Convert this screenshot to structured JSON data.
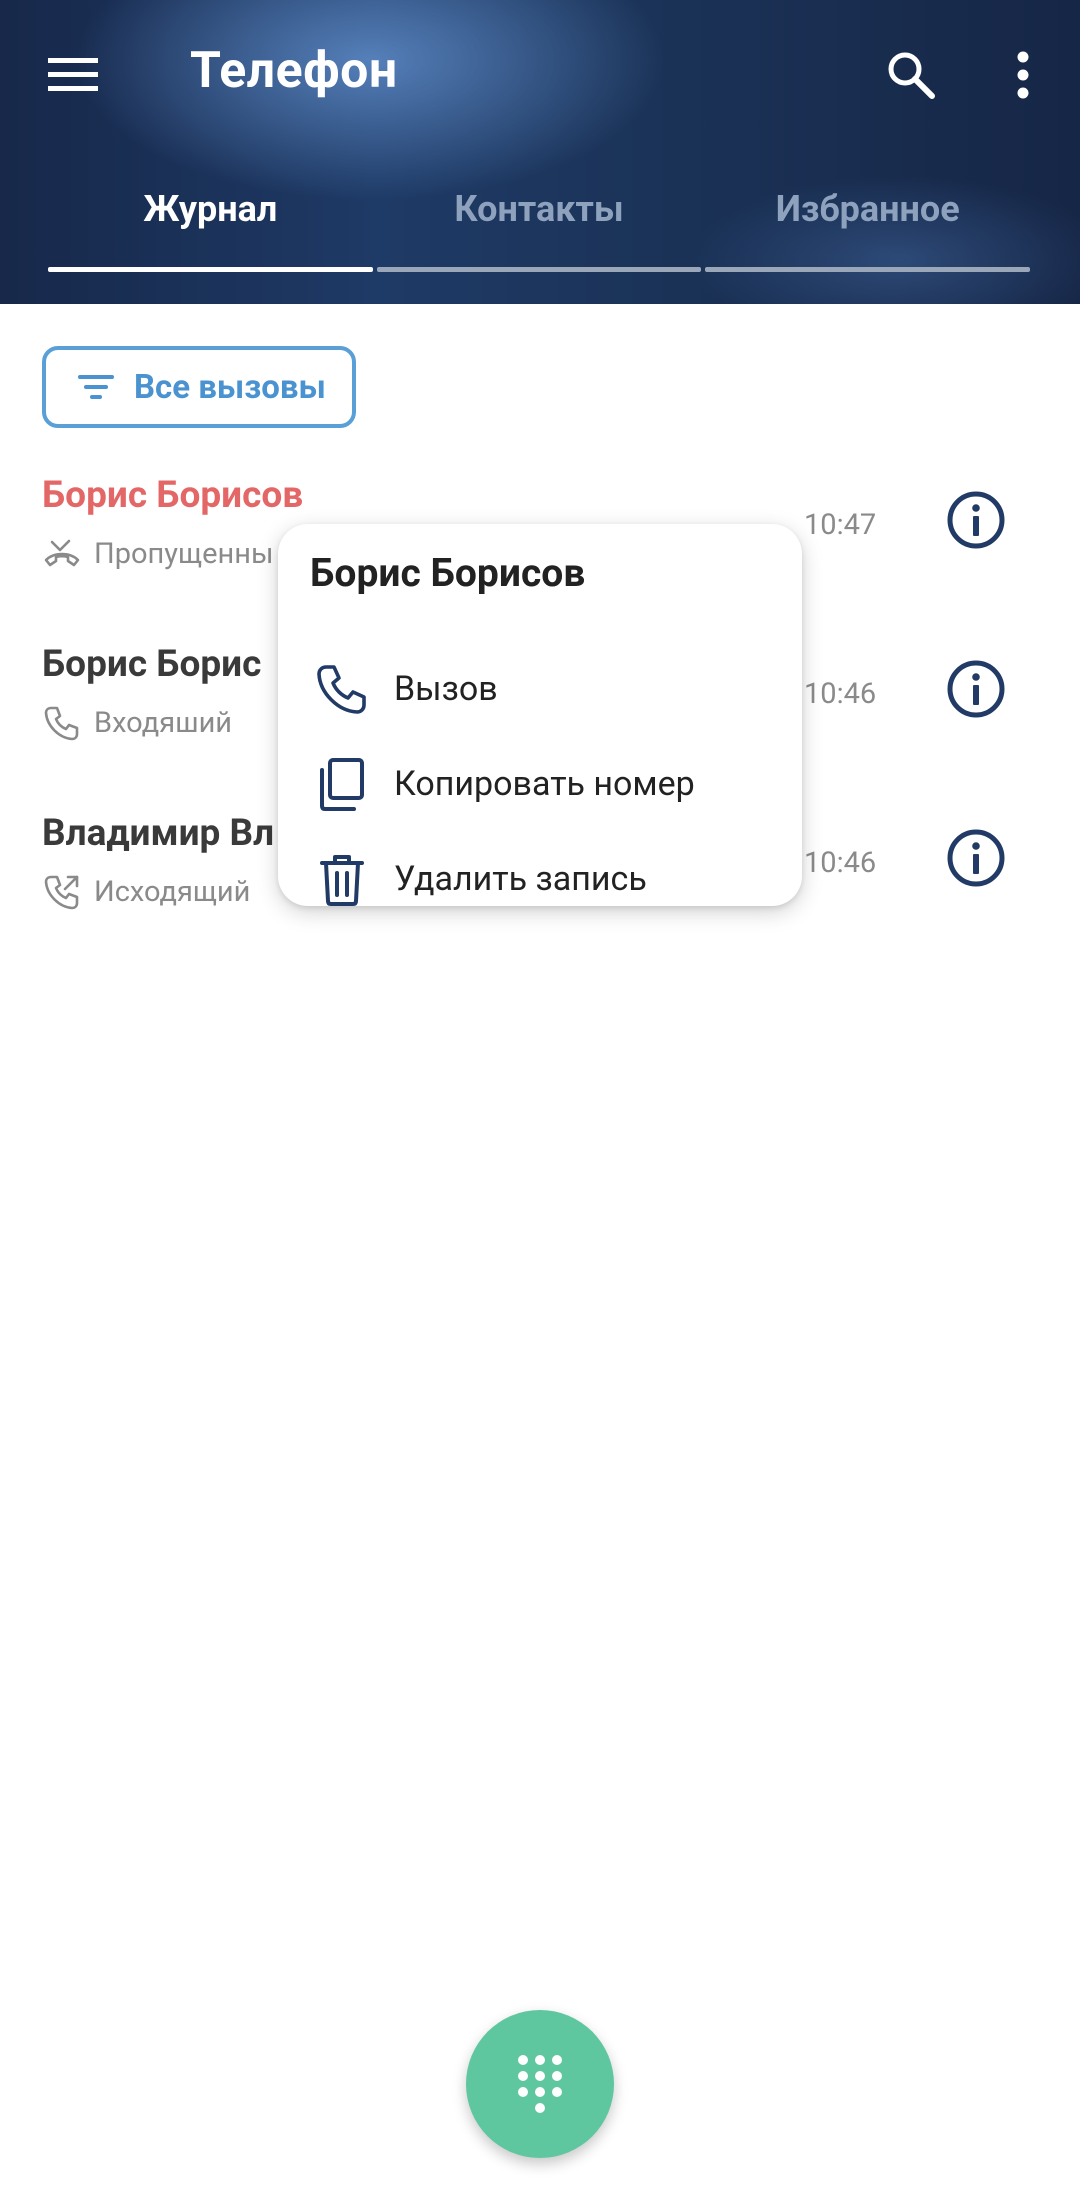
{
  "app": {
    "title": "Телефон"
  },
  "tabs": [
    {
      "label": "Журнал",
      "active": true
    },
    {
      "label": "Контакты",
      "active": false
    },
    {
      "label": "Избранное",
      "active": false
    }
  ],
  "filter": {
    "label": "Все вызовы",
    "icon": "filter-icon"
  },
  "calls": [
    {
      "name": "Борис Борисов",
      "type": "Пропущенны",
      "time": "10:47",
      "status": "missed",
      "icon": "missed-call-icon"
    },
    {
      "name": "Борис Борис",
      "type": "Входяший",
      "time": "10:46",
      "status": "incoming",
      "icon": "incoming-call-icon"
    },
    {
      "name": "Владимир Вл",
      "type": "Исходящий",
      "time": "10:46",
      "status": "outgoing",
      "icon": "outgoing-call-icon"
    }
  ],
  "context_menu": {
    "title": "Борис Борисов",
    "items": [
      {
        "label": "Вызов",
        "icon": "phone-icon"
      },
      {
        "label": "Копировать номер",
        "icon": "copy-icon"
      },
      {
        "label": "Удалить запись",
        "icon": "trash-icon"
      }
    ]
  },
  "fab": {
    "icon": "dialpad-icon"
  },
  "colors": {
    "header_dark": "#17284a",
    "accent_blue": "#4a93d0",
    "missed_red": "#e46767",
    "icon_navy": "#213a66",
    "fab_green": "#5ec7a0"
  }
}
